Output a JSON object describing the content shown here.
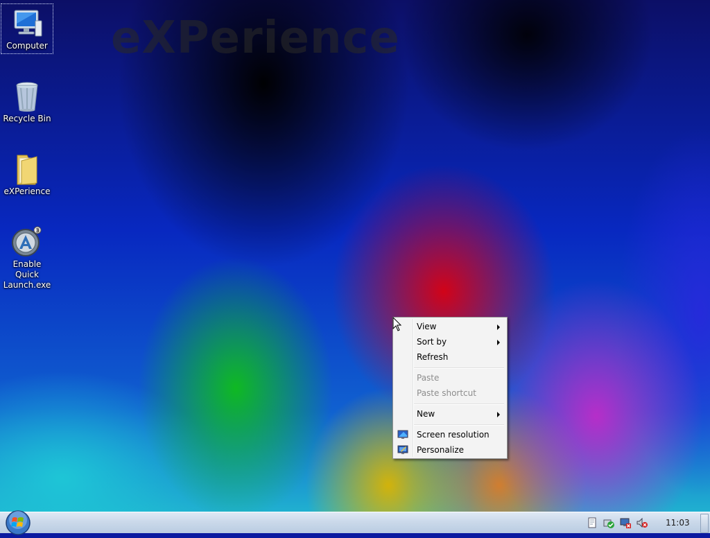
{
  "desktop": {
    "watermark": "eXPerience",
    "icons": [
      {
        "label": "Computer",
        "icon": "computer-icon"
      },
      {
        "label": "Recycle Bin",
        "icon": "recycle-bin-icon"
      },
      {
        "label": "eXPerience",
        "icon": "folder-icon"
      },
      {
        "label": "Enable Quick Launch.exe",
        "icon": "quick-launch-icon"
      }
    ]
  },
  "context_menu": {
    "items": [
      {
        "label": "View",
        "submenu": true
      },
      {
        "label": "Sort by",
        "submenu": true
      },
      {
        "label": "Refresh"
      },
      {
        "label": "Paste",
        "disabled": true
      },
      {
        "label": "Paste shortcut",
        "disabled": true
      },
      {
        "label": "New",
        "submenu": true
      },
      {
        "label": "Screen resolution",
        "icon": "screen-resolution-icon"
      },
      {
        "label": "Personalize",
        "icon": "personalize-icon"
      }
    ]
  },
  "taskbar": {
    "clock": "11:03",
    "tray_icons": [
      "action-center-icon",
      "security-shield-icon",
      "network-disconnected-icon",
      "volume-muted-icon"
    ]
  },
  "colors": {
    "menu_bg": "#f3f3f3",
    "taskbar_bg": "#cbd9ea",
    "disabled_text": "#8d8d8d"
  }
}
